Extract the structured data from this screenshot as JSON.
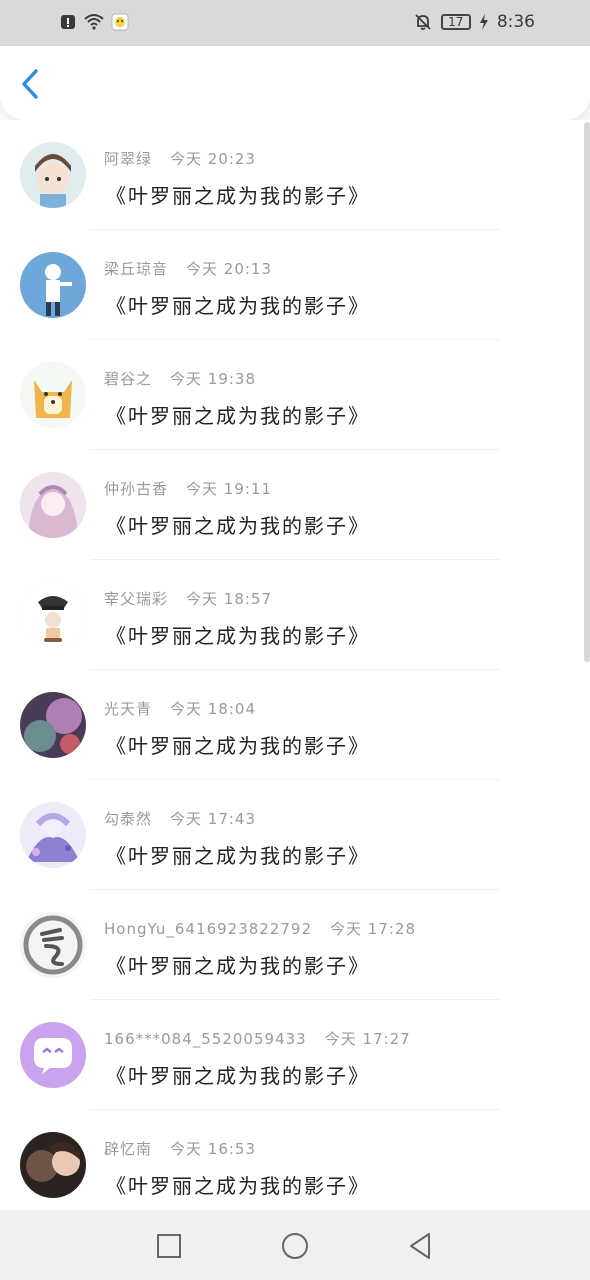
{
  "status_bar": {
    "time": "8:36",
    "battery": "17",
    "icons": [
      "alert-icon",
      "wifi-icon",
      "app-notification-icon",
      "bell-off-icon",
      "battery-icon",
      "charging-icon"
    ]
  },
  "header": {
    "back_icon": "chevron-left-icon"
  },
  "comments": [
    {
      "name": "阿翠绿",
      "time": "今天 20:23",
      "message": "《叶罗丽之成为我的影子》",
      "avatar_color": "#d8e6f0"
    },
    {
      "name": "梁丘琼音",
      "time": "今天 20:13",
      "message": "《叶罗丽之成为我的影子》",
      "avatar_color": "#6ea7d9"
    },
    {
      "name": "碧谷之",
      "time": "今天 19:38",
      "message": "《叶罗丽之成为我的影子》",
      "avatar_color": "#f3c56b"
    },
    {
      "name": "仲孙古香",
      "time": "今天 19:11",
      "message": "《叶罗丽之成为我的影子》",
      "avatar_color": "#e9d7e6"
    },
    {
      "name": "宰父瑞彩",
      "time": "今天 18:57",
      "message": "《叶罗丽之成为我的影子》",
      "avatar_color": "#ffffff"
    },
    {
      "name": "光天青",
      "time": "今天 18:04",
      "message": "《叶罗丽之成为我的影子》",
      "avatar_color": "#8a5d8f"
    },
    {
      "name": "勾泰然",
      "time": "今天 17:43",
      "message": "《叶罗丽之成为我的影子》",
      "avatar_color": "#8f7fd0"
    },
    {
      "name": "HongYu_6416923822792",
      "time": "今天 17:28",
      "message": "《叶罗丽之成为我的影子》",
      "avatar_color": "#e6e6e6"
    },
    {
      "name": "166***084_5520059433",
      "time": "今天 17:27",
      "message": "《叶罗丽之成为我的影子》",
      "avatar_color": "#c9a3ee"
    },
    {
      "name": "辟忆南",
      "time": "今天 16:53",
      "message": "《叶罗丽之成为我的影子》",
      "avatar_color": "#5a4a42"
    }
  ],
  "navbar": {
    "icons": [
      "square-icon",
      "circle-icon",
      "triangle-back-icon"
    ]
  }
}
